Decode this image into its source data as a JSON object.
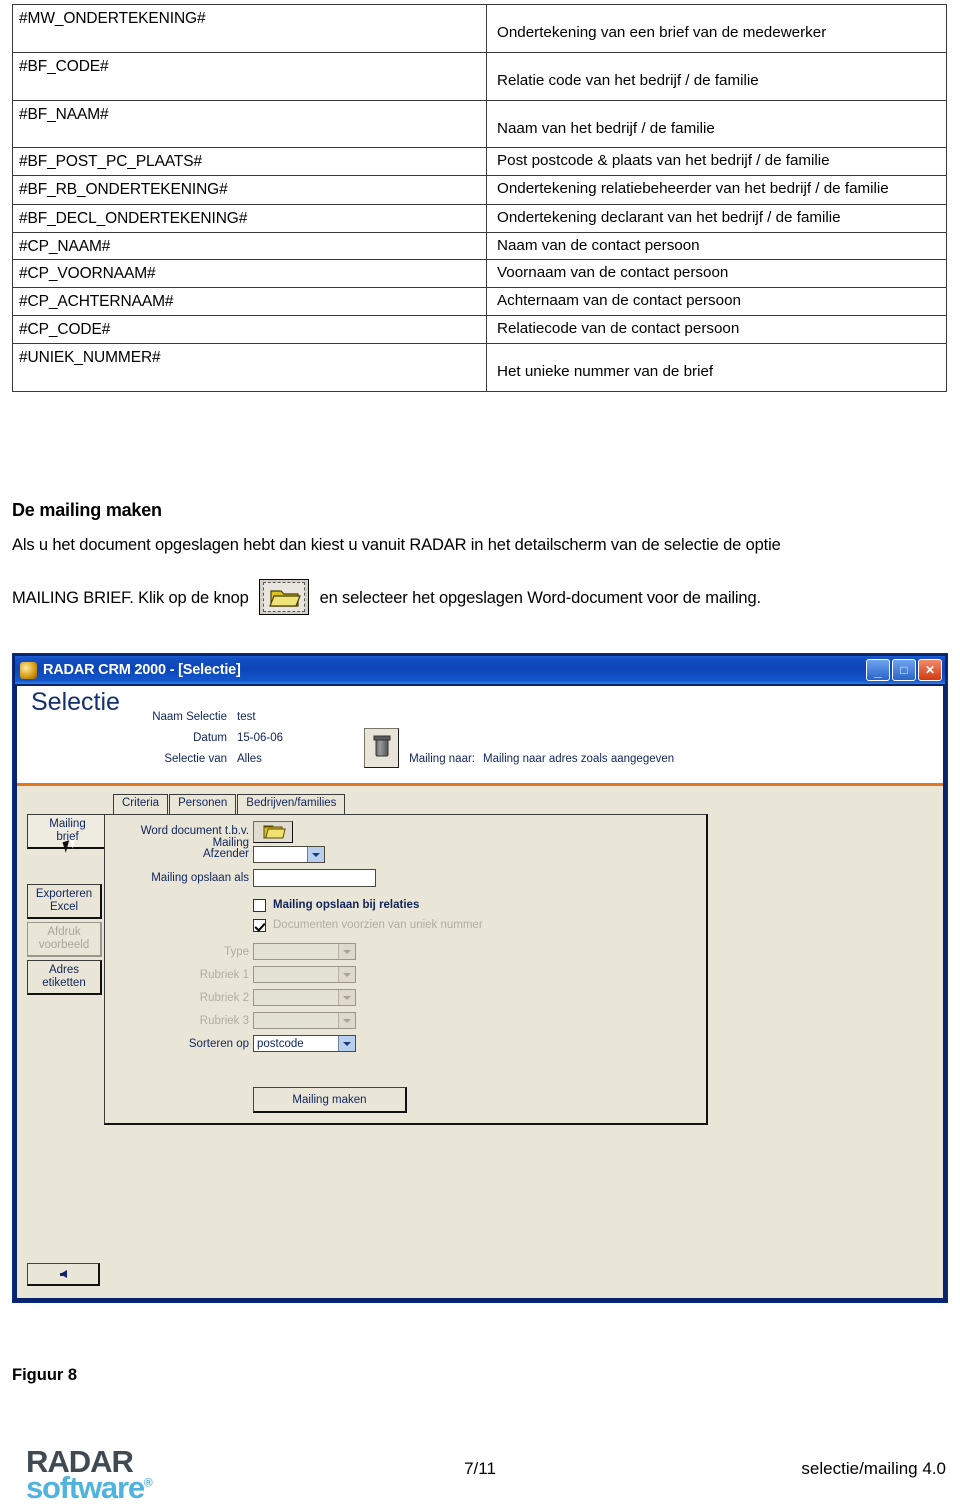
{
  "merge_table": {
    "rows": [
      {
        "code": "#MW_ONDERTEKENING#",
        "desc": "Ondertekening van een brief van de medewerker",
        "h": "tall"
      },
      {
        "code": "#BF_CODE#",
        "desc": "Relatie code van het bedrijf / de familie",
        "h": "tall"
      },
      {
        "code": "#BF_NAAM#",
        "desc": "Naam van het bedrijf / de familie",
        "h": "tall"
      },
      {
        "code": "#BF_POST_PC_PLAATS#",
        "desc": "Post postcode & plaats van het bedrijf / de familie",
        "h": "short"
      },
      {
        "code": "#BF_RB_ONDERTEKENING#",
        "desc": "Ondertekening relatiebeheerder van het bedrijf / de familie",
        "h": "two"
      },
      {
        "code": "#BF_DECL_ONDERTEKENING#",
        "desc": "Ondertekening declarant van het bedrijf / de familie",
        "h": "short"
      },
      {
        "code": "#CP_NAAM#",
        "desc": "Naam van de contact persoon",
        "h": "short"
      },
      {
        "code": "#CP_VOORNAAM#",
        "desc": "Voornaam van de contact persoon",
        "h": "short"
      },
      {
        "code": "#CP_ACHTERNAAM#",
        "desc": "Achternaam van de contact persoon",
        "h": "short"
      },
      {
        "code": "#CP_CODE#",
        "desc": "Relatiecode van de contact persoon",
        "h": "short"
      },
      {
        "code": "#UNIEK_NUMMER#",
        "desc": "Het unieke nummer van de brief",
        "h": "tall"
      }
    ]
  },
  "prose": {
    "heading": "De mailing maken",
    "paragraph1": "Als u het document opgeslagen hebt dan kiest u vanuit RADAR in het detailscherm van de selectie de optie",
    "paragraph2_before": "MAILING BRIEF. Klik op de knop",
    "paragraph2_after": "en selecteer het opgeslagen Word-document voor de mailing.",
    "inline_icon": "open-folder-icon"
  },
  "app": {
    "titlebar": {
      "icon": "radar-app-icon",
      "title": "RADAR CRM 2000 - [Selectie]",
      "minimize": "_",
      "restore": "□",
      "close": "✕"
    },
    "header": {
      "title": "Selectie",
      "fields": [
        {
          "label": "Naam Selectie",
          "value": "test"
        },
        {
          "label": "Datum",
          "value": "15-06-06"
        },
        {
          "label": "Selectie van",
          "value": "Alles"
        }
      ],
      "mailing_naar_label": "Mailing naar:",
      "mailing_naar_value": "Mailing naar adres zoals aangegeven",
      "delete_button_icon": "trash-icon",
      "divider_color": "#e07820"
    },
    "tabs": [
      {
        "label": "Criteria",
        "active": false
      },
      {
        "label": "Personen",
        "active": false
      },
      {
        "label": "Bedrijven/families",
        "active": false
      }
    ],
    "side_tabs": [
      {
        "label_line1": "Mailing",
        "label_line2": "brief",
        "state": "active"
      },
      {
        "label_line1": "Exporteren",
        "label_line2": "Excel",
        "state": "normal"
      },
      {
        "label_line1": "Afdruk",
        "label_line2": "voorbeeld",
        "state": "disabled"
      },
      {
        "label_line1": "Adres",
        "label_line2": "etiketten",
        "state": "normal"
      }
    ],
    "form": {
      "word_document_label": "Word document t.b.v. Mailing",
      "word_document_button_icon": "open-folder-icon",
      "afzender_label": "Afzender",
      "afzender_value": "",
      "mailing_opslaan_als_label": "Mailing opslaan als",
      "mailing_opslaan_als_value": "",
      "check_opslaan_bij_relaties": {
        "label": "Mailing opslaan bij relaties",
        "checked": false,
        "enabled": true
      },
      "check_uniek_nummer": {
        "label": "Documenten voorzien van uniek nummer",
        "checked": true,
        "enabled": false
      },
      "type_label": "Type",
      "type_value": "",
      "rubriek1_label": "Rubriek 1",
      "rubriek1_value": "",
      "rubriek2_label": "Rubriek 2",
      "rubriek2_value": "",
      "rubriek3_label": "Rubriek 3",
      "rubriek3_value": "",
      "sorteren_op_label": "Sorteren op",
      "sorteren_op_value": "postcode",
      "make_button_label": "Mailing maken"
    },
    "back_button_icon": "back-arrow-icon"
  },
  "figure_caption": "Figuur 8",
  "footer": {
    "logo_line1": "RADAR",
    "logo_line2": "software",
    "logo_trademark": "®",
    "page_number": "7/11",
    "doc_reference": "selectie/mailing 4.0"
  }
}
